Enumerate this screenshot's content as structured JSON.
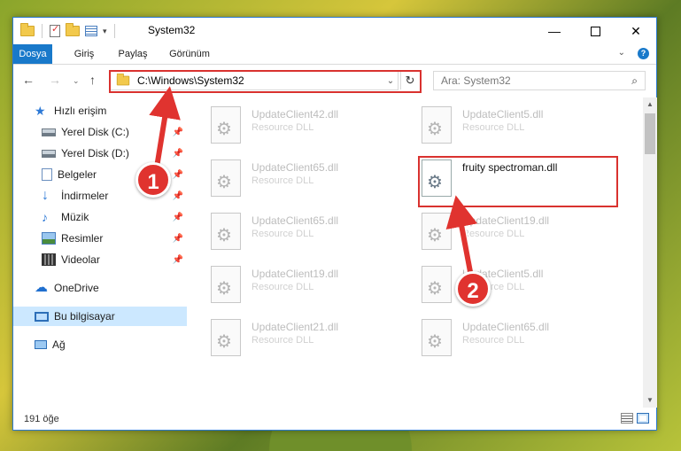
{
  "window": {
    "title": "System32",
    "controls": {
      "minimize": "—",
      "close": "✕"
    }
  },
  "ribbon": {
    "tabs": [
      "Dosya",
      "Giriş",
      "Paylaş",
      "Görünüm"
    ]
  },
  "navigation": {
    "address": "C:\\Windows\\System32",
    "search_placeholder": "Ara: System32"
  },
  "sidebar": {
    "items": [
      {
        "label": "Hızlı erişim",
        "icon": "star-icon"
      },
      {
        "label": "Yerel Disk (C:)",
        "icon": "drive-icon",
        "pinned": true
      },
      {
        "label": "Yerel Disk (D:)",
        "icon": "drive-icon",
        "pinned": true
      },
      {
        "label": "Belgeler",
        "icon": "documents-icon",
        "pinned": true
      },
      {
        "label": "İndirmeler",
        "icon": "download-icon",
        "pinned": true
      },
      {
        "label": "Müzik",
        "icon": "music-icon",
        "pinned": true
      },
      {
        "label": "Resimler",
        "icon": "pictures-icon",
        "pinned": true
      },
      {
        "label": "Videolar",
        "icon": "videos-icon",
        "pinned": true
      },
      {
        "label": "OneDrive",
        "icon": "onedrive-icon"
      },
      {
        "label": "Bu bilgisayar",
        "icon": "computer-icon",
        "selected": true
      },
      {
        "label": "Ağ",
        "icon": "network-icon"
      }
    ]
  },
  "files": [
    {
      "name": "UpdateClient42.dll",
      "type": "Resource DLL"
    },
    {
      "name": "UpdateClient5.dll",
      "type": "Resource DLL"
    },
    {
      "name": "UpdateClient65.dll",
      "type": "Resource DLL"
    },
    {
      "name": "fruity spectroman.dll",
      "type": ""
    },
    {
      "name": "UpdateClient65.dll",
      "type": "Resource DLL"
    },
    {
      "name": "UpdateClient19.dll",
      "type": "Resource DLL"
    },
    {
      "name": "UpdateClient19.dll",
      "type": "Resource DLL"
    },
    {
      "name": "UpdateClient5.dll",
      "type": "Resource DLL"
    },
    {
      "name": "UpdateClient21.dll",
      "type": "Resource DLL"
    },
    {
      "name": "UpdateClient65.dll",
      "type": "Resource DLL"
    }
  ],
  "status": {
    "item_count": "191 öğe"
  },
  "annotations": {
    "step1": "1",
    "step2": "2",
    "color": "#e0332f"
  }
}
